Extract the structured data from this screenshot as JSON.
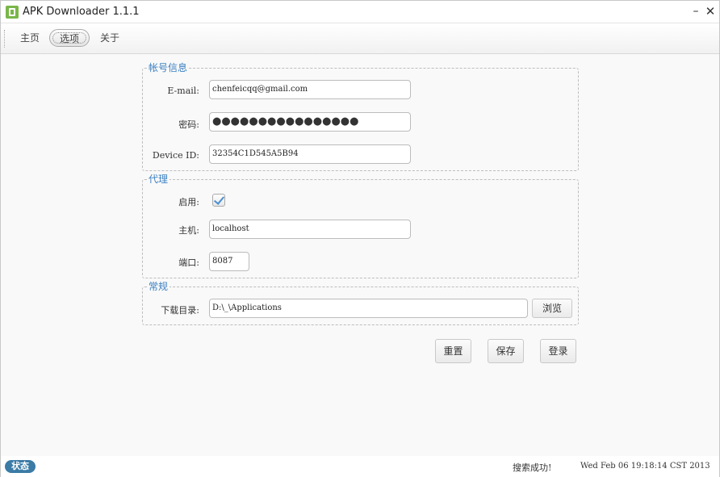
{
  "window": {
    "title": "APK Downloader 1.1.1",
    "minimize_glyph": "–",
    "close_glyph": "✕"
  },
  "toolbar": {
    "tabs": [
      {
        "label": "主页",
        "selected": false
      },
      {
        "label": "选项",
        "selected": true
      },
      {
        "label": "关于",
        "selected": false
      }
    ]
  },
  "account": {
    "legend": "帐号信息",
    "email_label": "E-mail:",
    "email_value": "chenfeicqq@gmail.com",
    "password_label": "密码:",
    "password_dots": "●●●●●●●●●●●●●●●●",
    "device_id_label": "Device ID:",
    "device_id_value": "32354C1D545A5B94"
  },
  "proxy": {
    "legend": "代理",
    "enable_label": "启用:",
    "enabled": true,
    "host_label": "主机:",
    "host_value": "localhost",
    "port_label": "端口:",
    "port_value": "8087"
  },
  "general": {
    "legend": "常规",
    "download_dir_label": "下载目录:",
    "download_dir_value": "D:\\_\\Applications",
    "browse_label": "浏览"
  },
  "actions": {
    "reset_label": "重置",
    "save_label": "保存",
    "login_label": "登录"
  },
  "status": {
    "badge": "状态",
    "message": "搜索成功!",
    "time": "Wed Feb 06 19:18:14 CST 2013"
  },
  "colors": {
    "legend": "#3a7fc1",
    "badge": "#3b7ba6",
    "check": "#4a8fd0"
  }
}
